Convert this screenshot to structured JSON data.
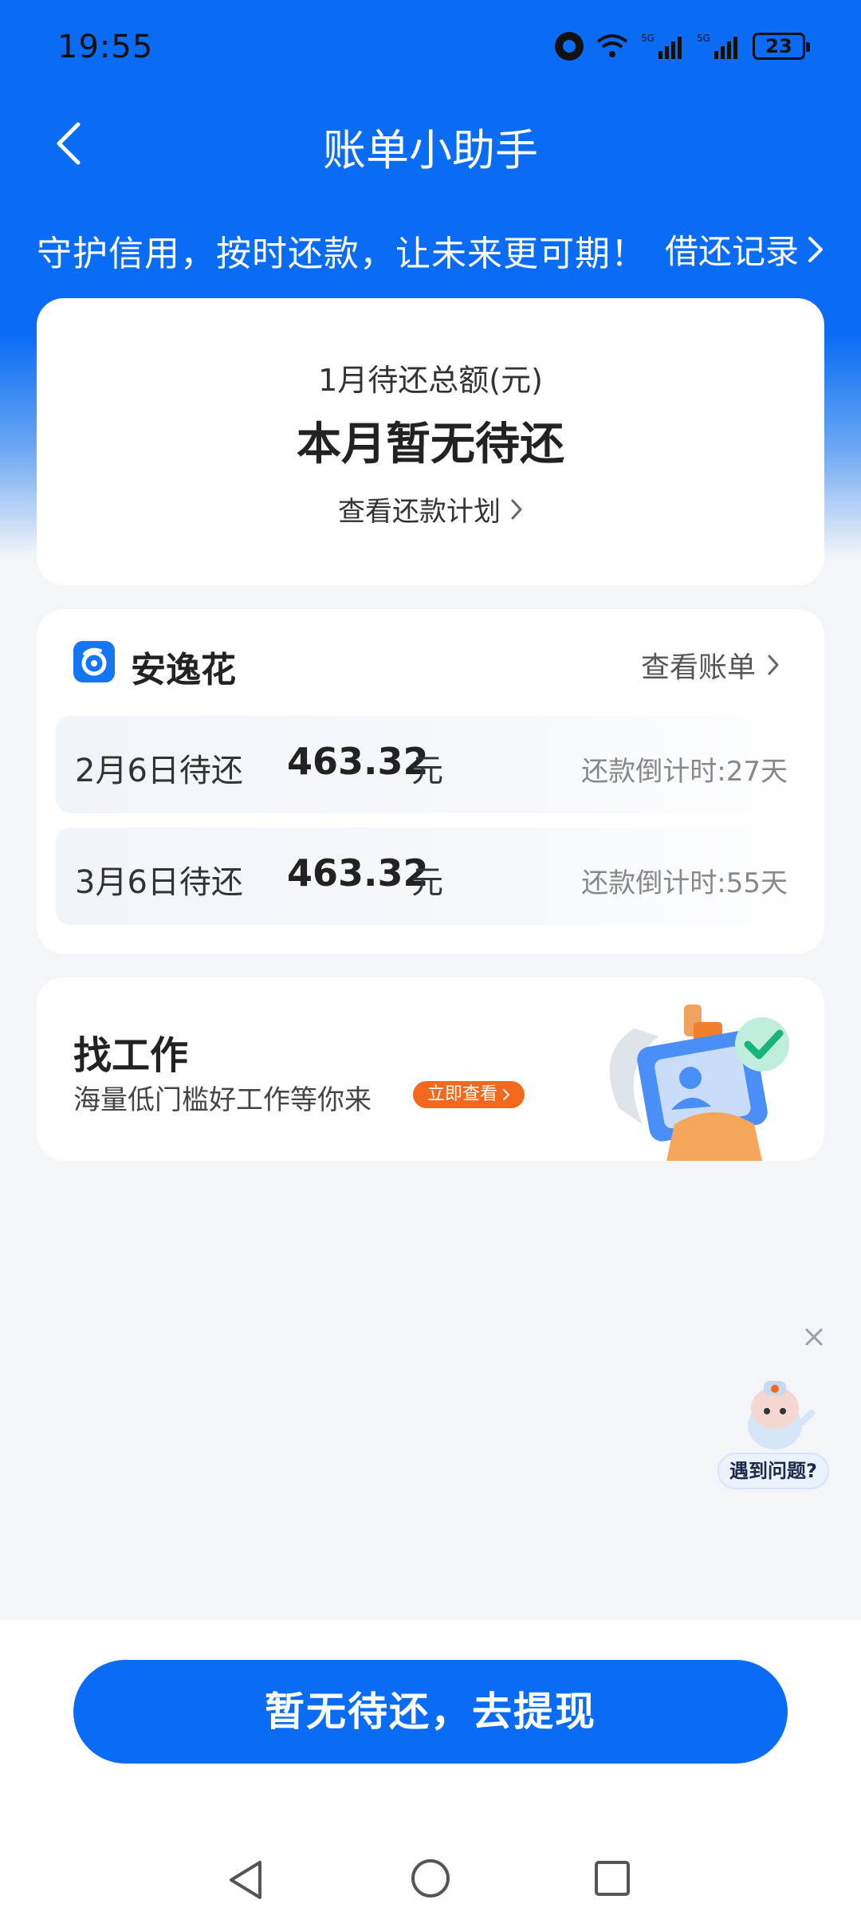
{
  "status_bar": {
    "time": "19:55",
    "battery": "23"
  },
  "header": {
    "title": "账单小助手"
  },
  "banner": {
    "slogan": "守护信用，按时还款，让未来更可期！",
    "history_link": "借还记录"
  },
  "summary": {
    "label": "1月待还总额(元)",
    "value": "本月暂无待还",
    "plan_link": "查看还款计划"
  },
  "bill": {
    "brand": "安逸花",
    "view_bill": "查看账单",
    "items": [
      {
        "date_label": "2月6日待还",
        "amount": "463.32",
        "unit": "元",
        "countdown": "还款倒计时:27天"
      },
      {
        "date_label": "3月6日待还",
        "amount": "463.32",
        "unit": "元",
        "countdown": "还款倒计时:55天"
      }
    ]
  },
  "job": {
    "title": "找工作",
    "subtitle": "海量低门槛好工作等你来",
    "button": "立即查看"
  },
  "helper": {
    "label": "遇到问题?"
  },
  "cta": {
    "label": "暂无待还，去提现"
  },
  "colors": {
    "primary": "#0a6cf5",
    "orange": "#f2681d",
    "background": "#f4f5f8"
  }
}
